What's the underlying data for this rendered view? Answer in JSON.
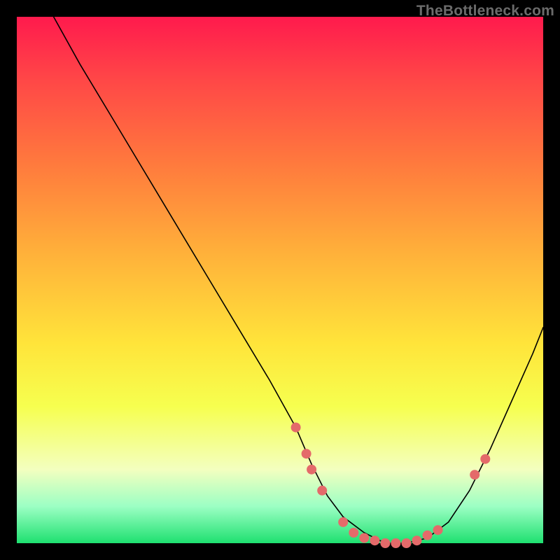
{
  "watermark": "TheBottleneck.com",
  "colors": {
    "background": "#000000",
    "gradient_top": "#ff1a4d",
    "gradient_bottom": "#1ee070",
    "curve": "#000000",
    "dots": "#e46a6a"
  },
  "chart_data": {
    "type": "line",
    "title": "",
    "xlabel": "",
    "ylabel": "",
    "xlim": [
      0,
      100
    ],
    "ylim": [
      0,
      100
    ],
    "grid": false,
    "legend": false,
    "series": [
      {
        "name": "bottleneck-curve",
        "x": [
          7,
          12,
          18,
          24,
          30,
          36,
          42,
          48,
          53,
          56,
          59,
          62,
          66,
          70,
          74,
          78,
          82,
          86,
          90,
          94,
          98,
          100
        ],
        "y": [
          100,
          91,
          81,
          71,
          61,
          51,
          41,
          31,
          22,
          15,
          9,
          5,
          2,
          0,
          0,
          1,
          4,
          10,
          18,
          27,
          36,
          41
        ]
      }
    ],
    "markers": [
      {
        "name": "marker-a",
        "x": 53,
        "y": 22
      },
      {
        "name": "marker-b",
        "x": 55,
        "y": 17
      },
      {
        "name": "marker-c",
        "x": 56,
        "y": 14
      },
      {
        "name": "marker-d",
        "x": 58,
        "y": 10
      },
      {
        "name": "marker-e",
        "x": 62,
        "y": 4
      },
      {
        "name": "marker-f",
        "x": 64,
        "y": 2
      },
      {
        "name": "marker-g",
        "x": 66,
        "y": 1
      },
      {
        "name": "marker-h",
        "x": 68,
        "y": 0.5
      },
      {
        "name": "marker-i",
        "x": 70,
        "y": 0
      },
      {
        "name": "marker-j",
        "x": 72,
        "y": 0
      },
      {
        "name": "marker-k",
        "x": 74,
        "y": 0
      },
      {
        "name": "marker-l",
        "x": 76,
        "y": 0.5
      },
      {
        "name": "marker-m",
        "x": 78,
        "y": 1.5
      },
      {
        "name": "marker-n",
        "x": 80,
        "y": 2.5
      },
      {
        "name": "marker-o",
        "x": 87,
        "y": 13
      },
      {
        "name": "marker-p",
        "x": 89,
        "y": 16
      }
    ]
  }
}
